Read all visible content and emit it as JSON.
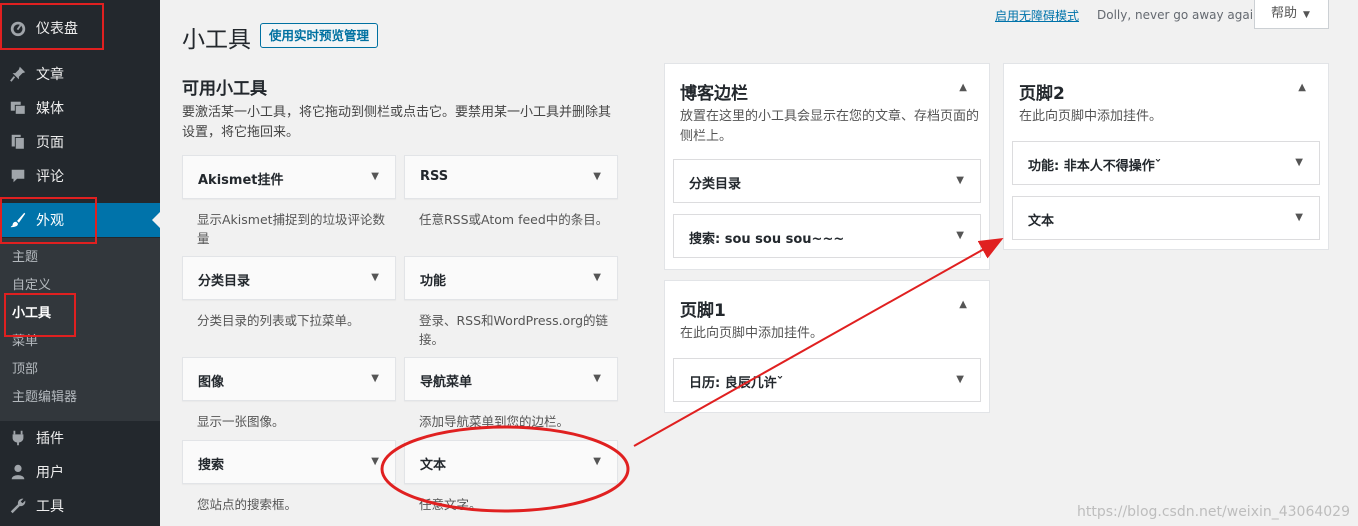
{
  "sidebar": {
    "items": [
      {
        "label": "仪表盘",
        "icon": "dashboard-icon"
      },
      {
        "label": "文章",
        "icon": "pin-icon"
      },
      {
        "label": "媒体",
        "icon": "media-icon"
      },
      {
        "label": "页面",
        "icon": "page-icon"
      },
      {
        "label": "评论",
        "icon": "comment-icon"
      },
      {
        "label": "外观",
        "icon": "brush-icon"
      },
      {
        "label": "插件",
        "icon": "plugin-icon"
      },
      {
        "label": "用户",
        "icon": "user-icon"
      },
      {
        "label": "工具",
        "icon": "wrench-icon"
      }
    ],
    "submenu": [
      "主题",
      "自定义",
      "小工具",
      "菜单",
      "顶部",
      "主题编辑器"
    ]
  },
  "header": {
    "title": "小工具",
    "manage_preview": "使用实时预览管理",
    "a11y_link": "启用无障碍模式",
    "hello_dolly": "Dolly, never go away again",
    "help": "帮助"
  },
  "available": {
    "title": "可用小工具",
    "description": "要激活某一小工具，将它拖动到侧栏或点击它。要禁用某一小工具并删除其设置，将它拖回来。",
    "widgets": [
      {
        "title": "Akismet挂件",
        "desc": "显示Akismet捕捉到的垃圾评论数量"
      },
      {
        "title": "RSS",
        "desc": "任意RSS或Atom feed中的条目。"
      },
      {
        "title": "分类目录",
        "desc": "分类目录的列表或下拉菜单。"
      },
      {
        "title": "功能",
        "desc": "登录、RSS和WordPress.org的链接。"
      },
      {
        "title": "图像",
        "desc": "显示一张图像。"
      },
      {
        "title": "导航菜单",
        "desc": "添加导航菜单到您的边栏。"
      },
      {
        "title": "搜索",
        "desc": "您站点的搜索框。"
      },
      {
        "title": "文本",
        "desc": "任意文字。"
      }
    ]
  },
  "sidebars": [
    {
      "title": "博客边栏",
      "desc": "放置在这里的小工具会显示在您的文章、存档页面的侧栏上。",
      "widgets": [
        "分类目录",
        "搜索: sou sou sou~~~"
      ]
    },
    {
      "title": "页脚1",
      "desc": "在此向页脚中添加挂件。",
      "widgets": [
        "日历: 良辰几许ˇ"
      ]
    },
    {
      "title": "页脚2",
      "desc": "在此向页脚中添加挂件。",
      "widgets": [
        "功能: 非本人不得操作ˇ",
        "文本"
      ]
    }
  ],
  "watermark": "https://blog.csdn.net/weixin_43064029",
  "colors": {
    "admin_bar": "#23282d",
    "submenu": "#32373c",
    "active": "#0073aa",
    "link": "#0073aa",
    "annotation": "#e02020"
  }
}
